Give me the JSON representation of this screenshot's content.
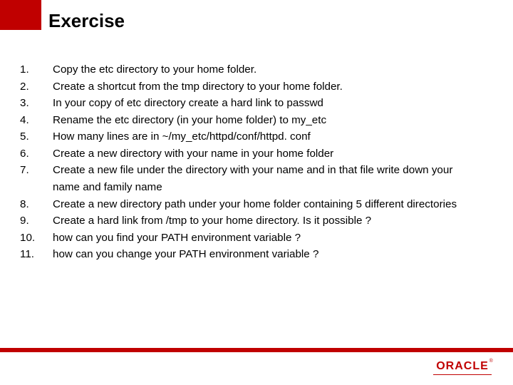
{
  "title": "Exercise",
  "items": [
    {
      "n": "1.",
      "t": "Copy the etc directory to your home folder."
    },
    {
      "n": "2.",
      "t": "Create a shortcut from the tmp directory to your home folder."
    },
    {
      "n": "3.",
      "t": "In your copy of etc directory create a hard link to passwd"
    },
    {
      "n": "4.",
      "t": "Rename the etc directory (in your home folder) to my_etc"
    },
    {
      "n": "5.",
      "t": "How many lines are in ~/my_etc/httpd/conf/httpd. conf"
    },
    {
      "n": "6.",
      "t": "Create a new directory with your name in your home folder"
    },
    {
      "n": "7.",
      "t": "Create a new file under the directory with your name and in that file write down your name and family name"
    },
    {
      "n": "8.",
      "t": "Create a new directory path under your home folder containing 5 different directories"
    },
    {
      "n": "9.",
      "t": "Create a hard link from /tmp to your home directory. Is it possible ?"
    },
    {
      "n": "10.",
      "t": "how can you find your PATH environment variable ?"
    },
    {
      "n": "11.",
      "t": "how can you change your PATH environment variable ?"
    }
  ],
  "logo": {
    "text": "ORACLE"
  }
}
